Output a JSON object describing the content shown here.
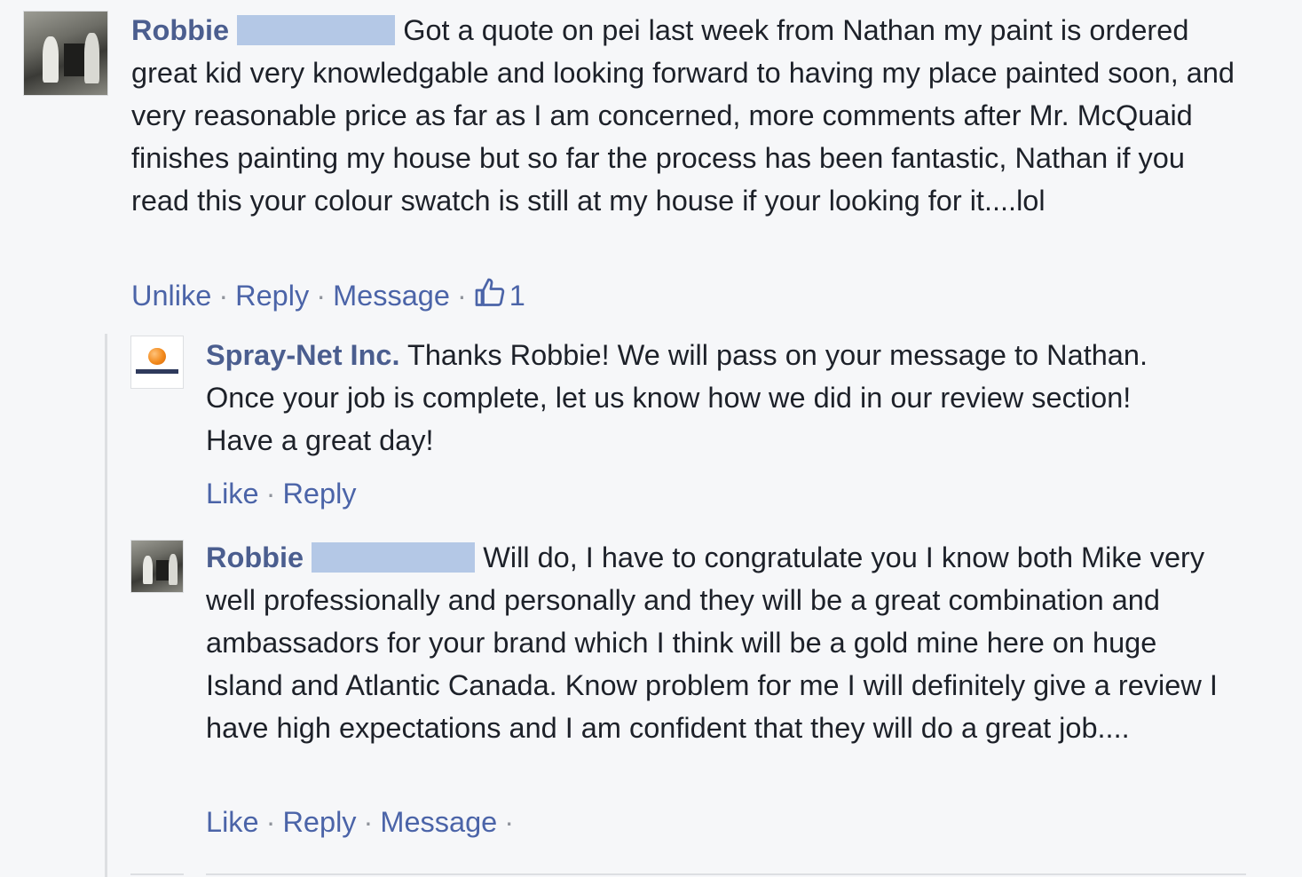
{
  "comments": [
    {
      "author": "Robbie",
      "text": "Got a quote on pei last week from Nathan my paint is ordered great kid very knowledgable and looking forward to having my place painted soon, and very reasonable price as far as I am concerned, more comments after Mr. McQuaid finishes painting my house but so far the process has been fantastic, Nathan if you read this your colour swatch is still at my house if your looking for it....lol",
      "actions": [
        "Unlike",
        "Reply",
        "Message"
      ],
      "like_count": "1"
    }
  ],
  "replies": [
    {
      "author": "Spray-Net Inc.",
      "text": "Thanks Robbie! We will pass on your message to Nathan. Once your job is complete, let us know how we did in our review section! Have a great day!",
      "actions": [
        "Like",
        "Reply"
      ]
    },
    {
      "author": "Robbie",
      "text": "Will do, I have to congratulate you I know both Mike very well professionally and personally and they will be a great combination and ambassadors for your brand which I think will be a gold mine here on huge Island and Atlantic Canada. Know problem for me I will definitely give a review I have high expectations and I am confident that they will do a great job....",
      "actions": [
        "Like",
        "Reply",
        "Message"
      ]
    }
  ],
  "icons": {
    "like": "thumbs-up-icon"
  },
  "colors": {
    "author": "#4b5e8f",
    "link": "#4b64a8",
    "text": "#1d2129",
    "background": "#f6f7f9",
    "redaction": "#b4c8e6"
  }
}
